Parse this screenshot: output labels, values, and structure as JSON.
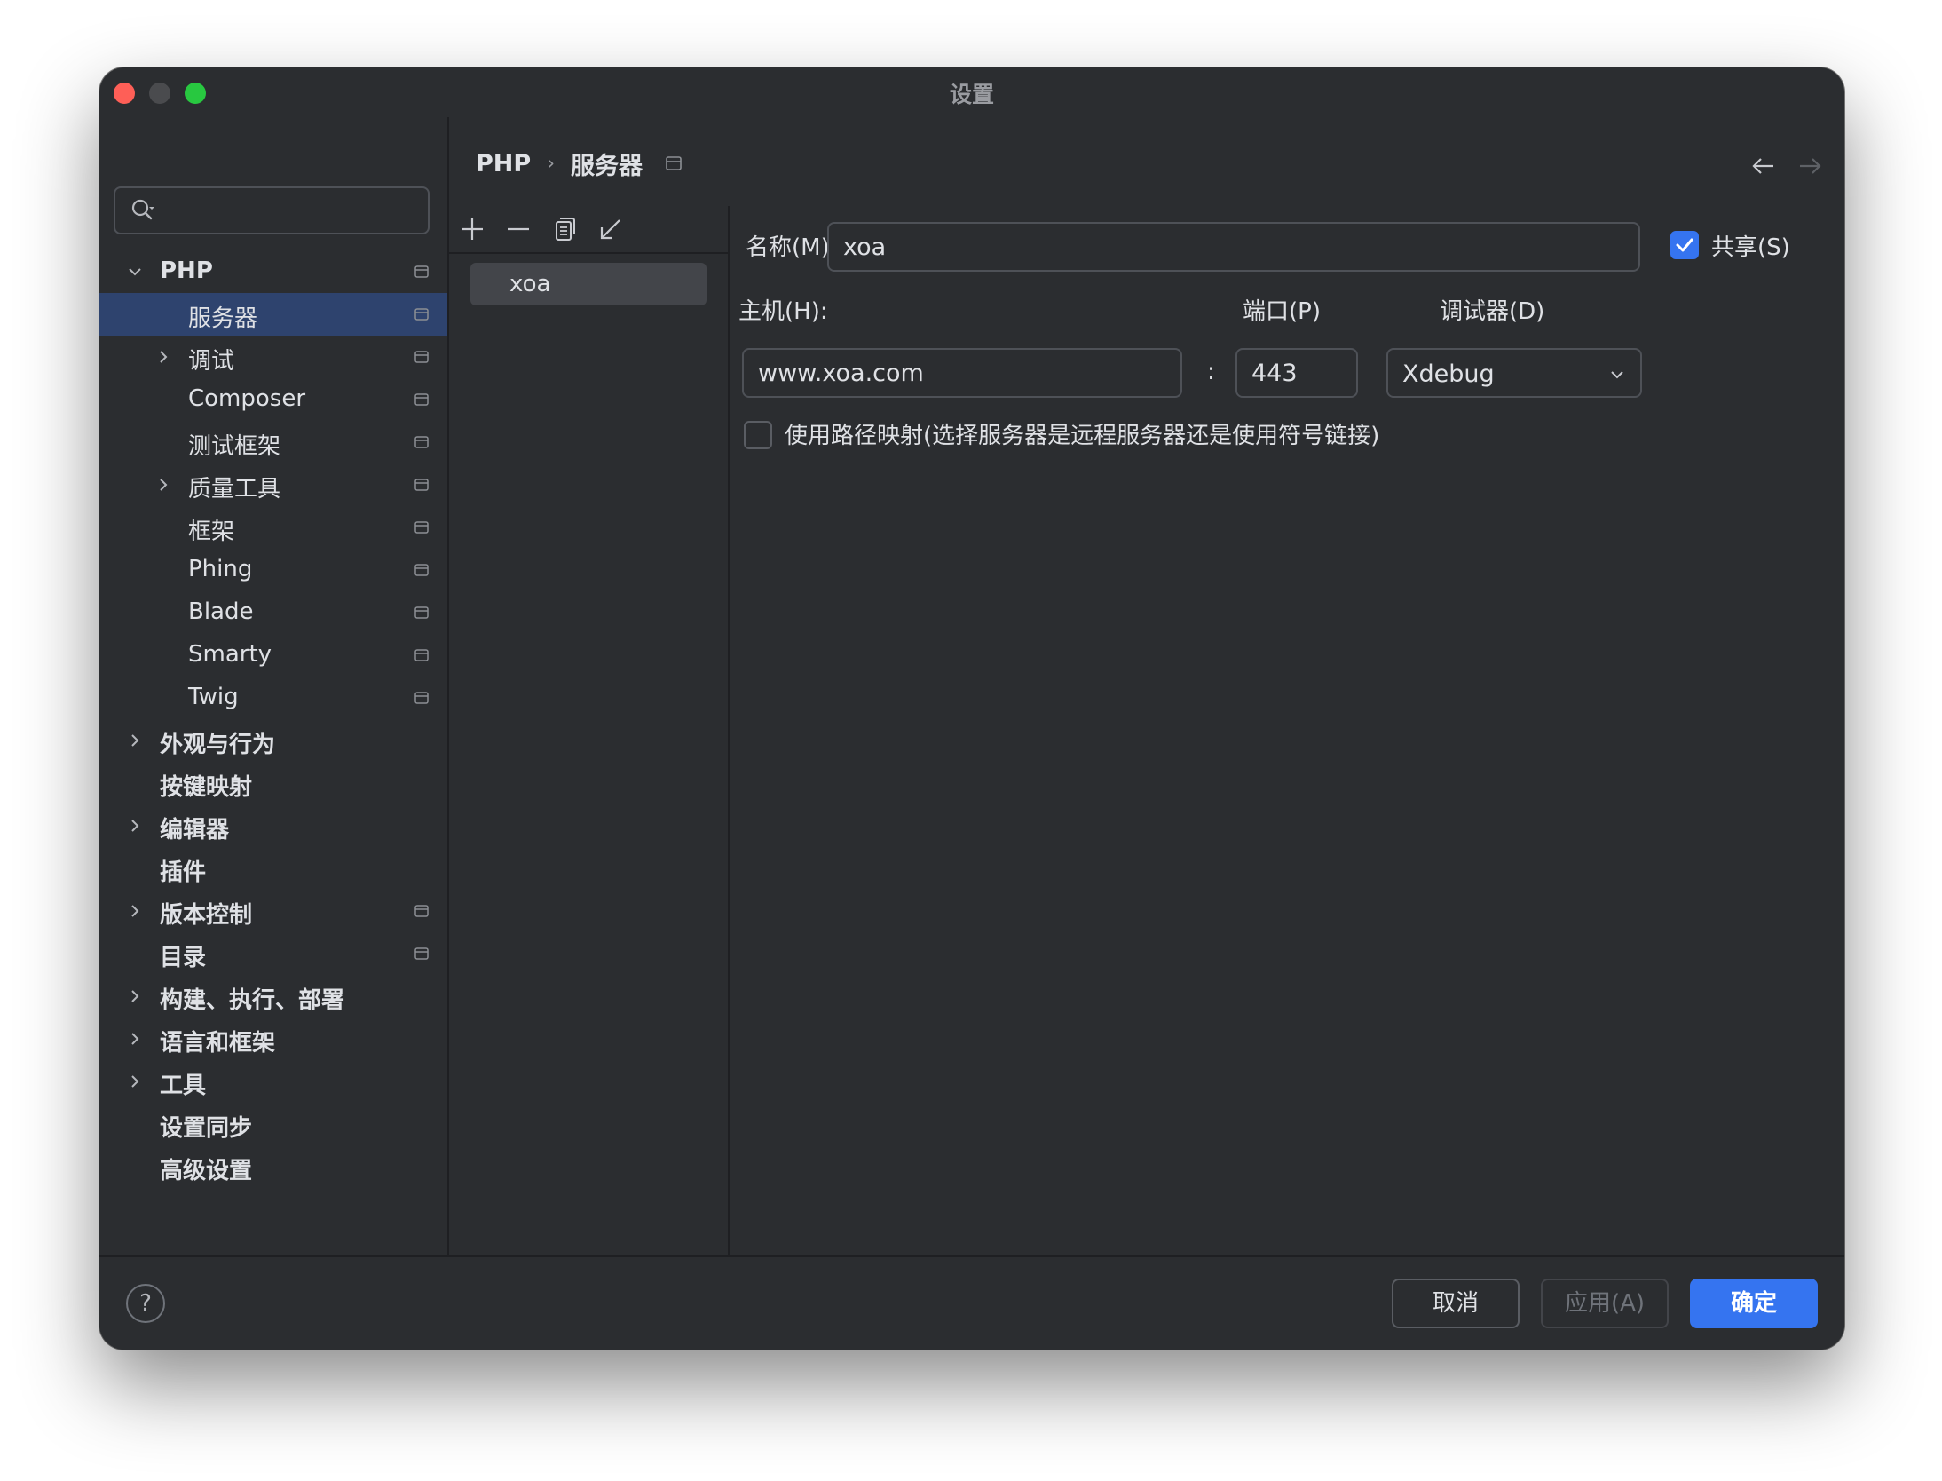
{
  "window": {
    "title": "设置"
  },
  "sidebar": {
    "search_placeholder": "",
    "items": [
      {
        "label": "PHP",
        "level": 0,
        "expander": "expanded",
        "project": true,
        "bold": true,
        "selected": false
      },
      {
        "label": "服务器",
        "level": 1,
        "expander": "none",
        "project": true,
        "bold": false,
        "selected": true
      },
      {
        "label": "调试",
        "level": 1,
        "expander": "collapsed",
        "project": true,
        "bold": false,
        "selected": false
      },
      {
        "label": "Composer",
        "level": 1,
        "expander": "none",
        "project": true,
        "bold": false,
        "selected": false
      },
      {
        "label": "测试框架",
        "level": 1,
        "expander": "none",
        "project": true,
        "bold": false,
        "selected": false
      },
      {
        "label": "质量工具",
        "level": 1,
        "expander": "collapsed",
        "project": true,
        "bold": false,
        "selected": false
      },
      {
        "label": "框架",
        "level": 1,
        "expander": "none",
        "project": true,
        "bold": false,
        "selected": false
      },
      {
        "label": "Phing",
        "level": 1,
        "expander": "none",
        "project": true,
        "bold": false,
        "selected": false
      },
      {
        "label": "Blade",
        "level": 1,
        "expander": "none",
        "project": true,
        "bold": false,
        "selected": false
      },
      {
        "label": "Smarty",
        "level": 1,
        "expander": "none",
        "project": true,
        "bold": false,
        "selected": false
      },
      {
        "label": "Twig",
        "level": 1,
        "expander": "none",
        "project": true,
        "bold": false,
        "selected": false
      },
      {
        "label": "外观与行为",
        "level": 0,
        "expander": "collapsed",
        "project": false,
        "bold": true,
        "selected": false
      },
      {
        "label": "按键映射",
        "level": 0,
        "expander": "none",
        "project": false,
        "bold": true,
        "selected": false
      },
      {
        "label": "编辑器",
        "level": 0,
        "expander": "collapsed",
        "project": false,
        "bold": true,
        "selected": false
      },
      {
        "label": "插件",
        "level": 0,
        "expander": "none",
        "project": false,
        "bold": true,
        "selected": false
      },
      {
        "label": "版本控制",
        "level": 0,
        "expander": "collapsed",
        "project": true,
        "bold": true,
        "selected": false
      },
      {
        "label": "目录",
        "level": 0,
        "expander": "none",
        "project": true,
        "bold": true,
        "selected": false
      },
      {
        "label": "构建、执行、部署",
        "level": 0,
        "expander": "collapsed",
        "project": false,
        "bold": true,
        "selected": false
      },
      {
        "label": "语言和框架",
        "level": 0,
        "expander": "collapsed",
        "project": false,
        "bold": true,
        "selected": false
      },
      {
        "label": "工具",
        "level": 0,
        "expander": "collapsed",
        "project": false,
        "bold": true,
        "selected": false
      },
      {
        "label": "设置同步",
        "level": 0,
        "expander": "none",
        "project": false,
        "bold": true,
        "selected": false
      },
      {
        "label": "高级设置",
        "level": 0,
        "expander": "none",
        "project": false,
        "bold": true,
        "selected": false
      }
    ]
  },
  "breadcrumb": {
    "parent": "PHP",
    "separator": "›",
    "current": "服务器"
  },
  "servers": {
    "items": [
      {
        "name": "xoa",
        "selected": true
      }
    ]
  },
  "form": {
    "name_label": "名称(M):",
    "name_value": "xoa",
    "shared_label": "共享(S)",
    "shared_checked": true,
    "host_label": "主机(H):",
    "host_value": "www.xoa.com",
    "colon": ":",
    "port_label": "端口(P)",
    "port_value": "443",
    "debugger_label": "调试器(D)",
    "debugger_value": "Xdebug",
    "path_mapping_label": "使用路径映射(选择服务器是远程服务器还是使用符号链接)",
    "path_mapping_checked": false
  },
  "footer": {
    "help": "?",
    "cancel": "取消",
    "apply": "应用(A)",
    "ok": "确定"
  },
  "colors": {
    "background": "#2b2d30",
    "selection": "#2e436e",
    "accent": "#3574f0",
    "border": "#4e5157"
  }
}
